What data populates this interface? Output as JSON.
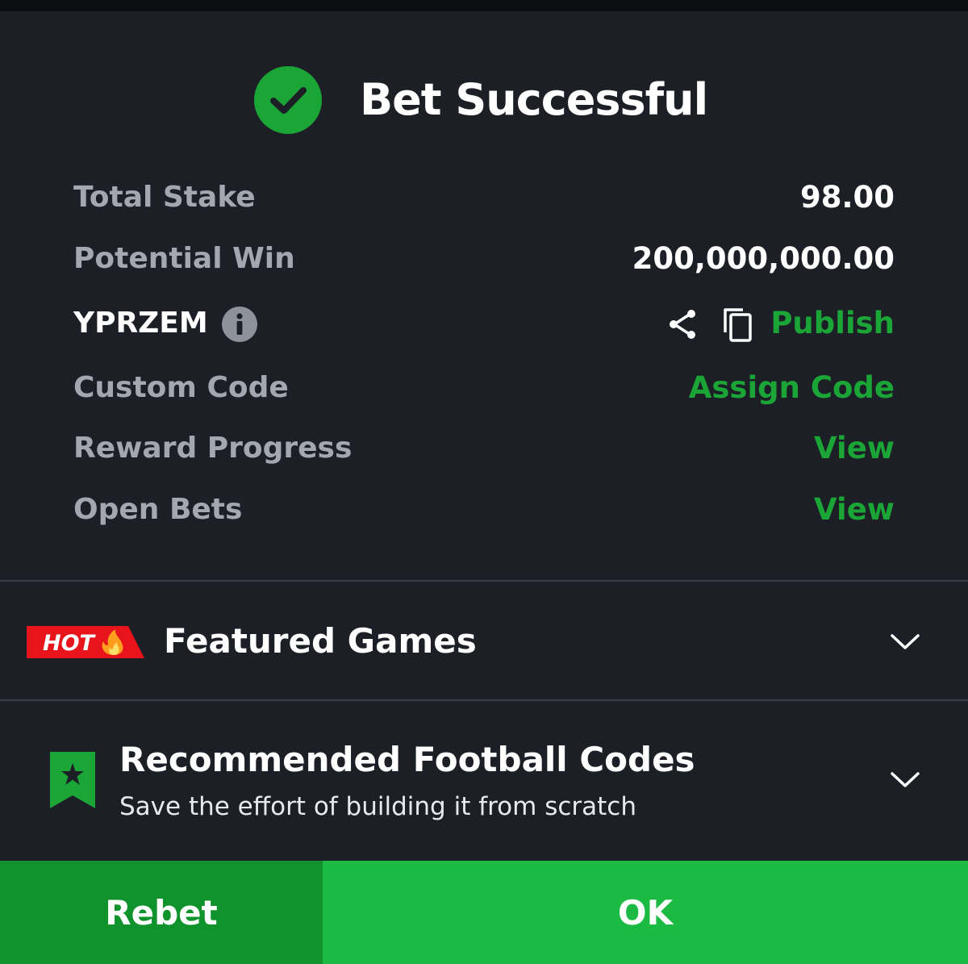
{
  "header": {
    "title": "Bet Successful",
    "icon": "check-circle-icon"
  },
  "details": {
    "total_stake": {
      "label": "Total Stake",
      "value": "98.00"
    },
    "potential_win": {
      "label": "Potential Win",
      "value": "200,000,000.00"
    },
    "booking_code": {
      "code": "YPRZEM",
      "publish_label": "Publish"
    },
    "custom_code": {
      "label": "Custom Code",
      "action": "Assign Code"
    },
    "reward_progress": {
      "label": "Reward Progress",
      "action": "View"
    },
    "open_bets": {
      "label": "Open Bets",
      "action": "View"
    }
  },
  "featured": {
    "badge": "HOT",
    "title": "Featured Games"
  },
  "recommended": {
    "title": "Recommended Football Codes",
    "subtitle": "Save the effort of building it from scratch"
  },
  "footer": {
    "rebet_label": "Rebet",
    "ok_label": "OK"
  },
  "colors": {
    "background": "#1c1f26",
    "accent_green": "#1aa536",
    "ok_button": "#1bbb43",
    "rebet_button": "#10932c",
    "hot_red": "#e8141c",
    "muted_text": "#a3a7b0"
  }
}
